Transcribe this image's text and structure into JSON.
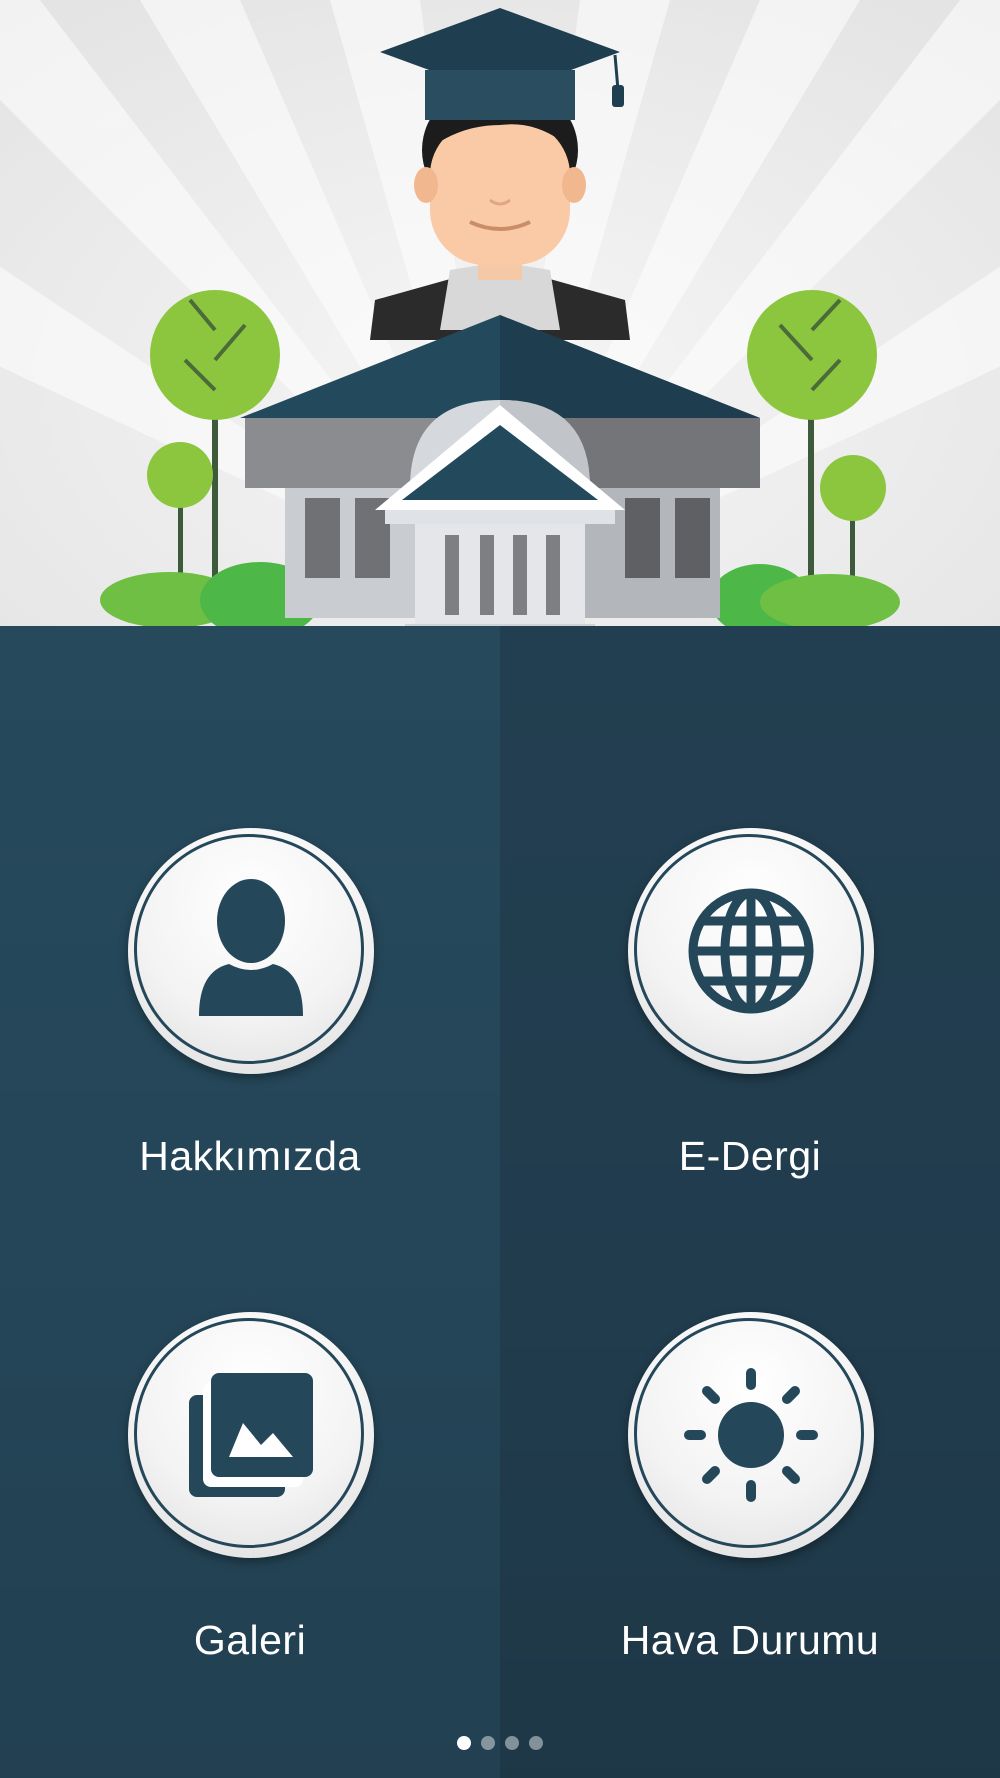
{
  "hero": {
    "illustration": "graduate-and-school-building"
  },
  "menu": {
    "items": [
      {
        "label": "Hakkımızda",
        "icon": "person-icon"
      },
      {
        "label": "E-Dergi",
        "icon": "globe-icon"
      },
      {
        "label": "Galeri",
        "icon": "gallery-icon"
      },
      {
        "label": "Hava Durumu",
        "icon": "sun-icon"
      }
    ]
  },
  "pager": {
    "total": 4,
    "active_index": 0
  },
  "colors": {
    "panel": "#24475a",
    "roof": "#234a5c",
    "tree_green": "#8cc63f",
    "bush_green": "#4db848",
    "hero_background": "#ececec"
  }
}
